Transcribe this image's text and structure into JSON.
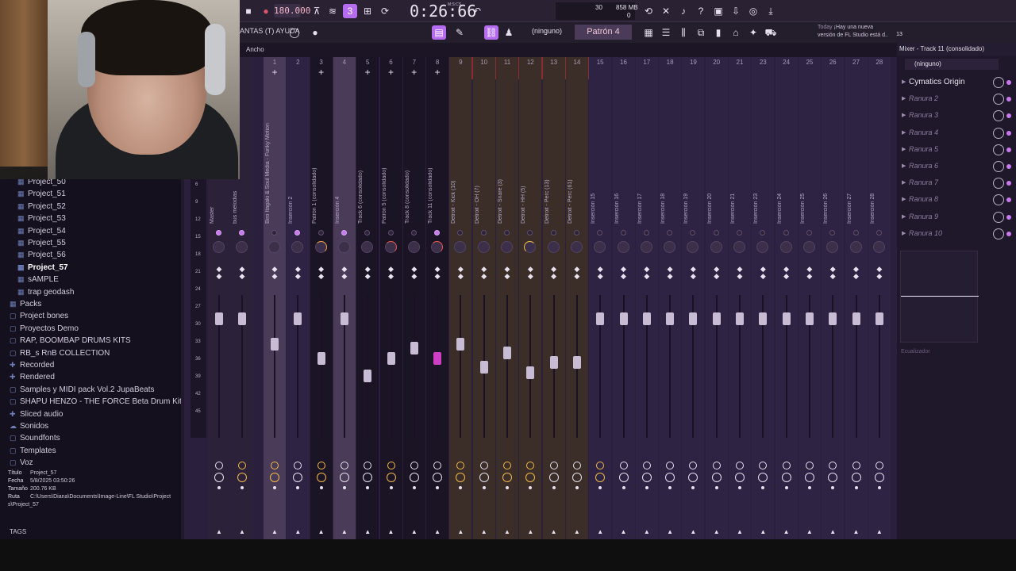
{
  "toolbar": {
    "tempo": "180.000",
    "timer": "0:26:66",
    "mcs": "M:S:CS",
    "cpu": "30",
    "memory": "858 MB",
    "zero": "0",
    "menu_text": "ANTAS (T) AYUDA",
    "snap": "(ninguno)",
    "pattern": "Patrón 4",
    "news_today": "Today",
    "news_line1": "¡Hay una nueva",
    "news_line2": "versión de FL Studio está d..",
    "news_count": "13"
  },
  "browser": {
    "items": [
      {
        "label": "Project_50",
        "icon": "▦",
        "top": 0
      },
      {
        "label": "Project_51",
        "icon": "▦"
      },
      {
        "label": "Project_52",
        "icon": "▦"
      },
      {
        "label": "Project_53",
        "icon": "▦"
      },
      {
        "label": "Project_54",
        "icon": "▦"
      },
      {
        "label": "Project_55",
        "icon": "▦"
      },
      {
        "label": "Project_56",
        "icon": "▦"
      },
      {
        "label": "Project_57",
        "icon": "▦"
      },
      {
        "label": "sAMPLE",
        "icon": "▦"
      },
      {
        "label": "trap geodash",
        "icon": "▦"
      },
      {
        "label": "Packs",
        "icon": "▦"
      },
      {
        "label": "Project bones",
        "icon": "▢"
      },
      {
        "label": "Proyectos Demo",
        "icon": "▢"
      },
      {
        "label": "RAP, BOOMBAP DRUMS KITS",
        "icon": "▢"
      },
      {
        "label": "RB_s RnB COLLECTION",
        "icon": "▢"
      },
      {
        "label": "Recorded",
        "icon": "✚"
      },
      {
        "label": "Rendered",
        "icon": "✚"
      },
      {
        "label": "Samples y MIDI pack Vol.2 JupaBeats",
        "icon": "▢"
      },
      {
        "label": "SHAPU HENZO - THE FORCE Beta Drum Kit",
        "icon": "▢"
      },
      {
        "label": "Sliced audio",
        "icon": "✚"
      },
      {
        "label": "Sonidos",
        "icon": "☁"
      },
      {
        "label": "Soundfonts",
        "icon": "▢"
      },
      {
        "label": "Templates",
        "icon": "▢"
      },
      {
        "label": "Voz",
        "icon": "▢"
      }
    ],
    "info": {
      "titulo_k": "Título",
      "titulo_v": "Project_57",
      "fecha_k": "Fecha",
      "fecha_v": "5/8/2025 03:50:26",
      "tamano_k": "Tamaño",
      "tamano_v": "200.76 KB",
      "ruta_k": "Ruta",
      "ruta_v": "C:\\Users\\Diana\\Documents\\Image-Line\\FL Studio\\Project",
      "ruta_v2": "s\\Project_57"
    },
    "tags_label": "TAGS"
  },
  "mixer": {
    "width_label": "Ancho",
    "ruler": [
      "6",
      "9",
      "12",
      "15",
      "18",
      "21",
      "24",
      "27",
      "30",
      "33",
      "36",
      "39",
      "42",
      "45"
    ],
    "tracks": [
      {
        "num": "",
        "name": "Master",
        "band": "band-d",
        "fader": 0.12,
        "send": true,
        "io_gold": false,
        "plus": false
      },
      {
        "num": "",
        "name": "bus melodias",
        "band": "band-d",
        "fader": 0.12,
        "send": true,
        "io_gold": true,
        "plus": false
      },
      {
        "num": "1",
        "name": "Biro Itagaki & Soul Media - Funky Motion",
        "band": "band-a",
        "fader": 0.3,
        "send": false,
        "io_gold": true,
        "plus": true
      },
      {
        "num": "2",
        "name": "Inserción 2",
        "band": "band-b",
        "fader": 0.12,
        "send": true,
        "io_gold": false,
        "plus": false
      },
      {
        "num": "3",
        "name": "Patrón 1 (consolidado)",
        "band": "band-dark",
        "fader": 0.4,
        "send": false,
        "io_gold": true,
        "plus": true
      },
      {
        "num": "4",
        "name": "Inserción 4",
        "band": "band-a",
        "fader": 0.12,
        "send": true,
        "io_gold": false,
        "plus": false
      },
      {
        "num": "5",
        "name": "Track 6 (consolidado)",
        "band": "band-dark",
        "fader": 0.52,
        "send": false,
        "io_gold": false,
        "plus": true
      },
      {
        "num": "6",
        "name": "Patrón 5 (consolidado)",
        "band": "band-dark",
        "fader": 0.4,
        "send": false,
        "io_gold": true,
        "plus": true
      },
      {
        "num": "7",
        "name": "Track 8 (consolidado)",
        "band": "band-dark",
        "fader": 0.33,
        "send": false,
        "io_gold": false,
        "plus": true
      },
      {
        "num": "8",
        "name": "Track 11 (consolidado)",
        "band": "band-dark",
        "fader": 0.4,
        "send": true,
        "io_gold": false,
        "plus": true,
        "active": true
      },
      {
        "num": "9",
        "name": "Detroit - Kick (10)",
        "band": "band-c",
        "fader": 0.3,
        "send": false,
        "io_gold": true,
        "plus": false
      },
      {
        "num": "10",
        "name": "Detroit - OH (7)",
        "band": "band-c",
        "fader": 0.46,
        "send": false,
        "io_gold": false,
        "plus": false
      },
      {
        "num": "11",
        "name": "Detroit - Snare (3)",
        "band": "band-c",
        "fader": 0.36,
        "send": false,
        "io_gold": true,
        "plus": false
      },
      {
        "num": "12",
        "name": "Detroit - HH (5)",
        "band": "band-c",
        "fader": 0.5,
        "send": false,
        "io_gold": true,
        "plus": false
      },
      {
        "num": "13",
        "name": "Detroit - Perc (13)",
        "band": "band-c",
        "fader": 0.43,
        "send": false,
        "io_gold": false,
        "plus": false
      },
      {
        "num": "14",
        "name": "Detroit - Perc (61)",
        "band": "band-c",
        "fader": 0.43,
        "send": false,
        "io_gold": false,
        "plus": false
      },
      {
        "num": "15",
        "name": "Inserción 15",
        "band": "band-b",
        "fader": 0.12,
        "send": false,
        "io_gold": true,
        "plus": false
      },
      {
        "num": "16",
        "name": "Inserción 16",
        "band": "band-b",
        "fader": 0.12,
        "send": false,
        "io_gold": false,
        "plus": false
      },
      {
        "num": "17",
        "name": "Inserción 17",
        "band": "band-b",
        "fader": 0.12,
        "send": false,
        "io_gold": false,
        "plus": false
      },
      {
        "num": "18",
        "name": "Inserción 18",
        "band": "band-b",
        "fader": 0.12,
        "send": false,
        "io_gold": false,
        "plus": false
      },
      {
        "num": "19",
        "name": "Inserción 19",
        "band": "band-b",
        "fader": 0.12,
        "send": false,
        "io_gold": false,
        "plus": false
      },
      {
        "num": "20",
        "name": "Inserción 20",
        "band": "band-b",
        "fader": 0.12,
        "send": false,
        "io_gold": false,
        "plus": false
      },
      {
        "num": "21",
        "name": "Inserción 21",
        "band": "band-b",
        "fader": 0.12,
        "send": false,
        "io_gold": false,
        "plus": false
      },
      {
        "num": "23",
        "name": "Inserción 23",
        "band": "band-b",
        "fader": 0.12,
        "send": false,
        "io_gold": false,
        "plus": false
      },
      {
        "num": "24",
        "name": "Inserción 24",
        "band": "band-b",
        "fader": 0.12,
        "send": false,
        "io_gold": false,
        "plus": false
      },
      {
        "num": "25",
        "name": "Inserción 25",
        "band": "band-b",
        "fader": 0.12,
        "send": false,
        "io_gold": false,
        "plus": false
      },
      {
        "num": "26",
        "name": "Inserción 26",
        "band": "band-b",
        "fader": 0.12,
        "send": false,
        "io_gold": false,
        "plus": false
      },
      {
        "num": "27",
        "name": "Inserción 27",
        "band": "band-b",
        "fader": 0.12,
        "send": false,
        "io_gold": false,
        "plus": false
      },
      {
        "num": "28",
        "name": "Inserción 28",
        "band": "band-b",
        "fader": 0.12,
        "send": false,
        "io_gold": false,
        "plus": false
      }
    ]
  },
  "right_panel": {
    "title": "Mixer - Track 11 (consolidado)",
    "none": "(ninguno)",
    "slots": [
      "Cymatics Origin",
      "Ranura 2",
      "Ranura 3",
      "Ranura 4",
      "Ranura 5",
      "Ranura 6",
      "Ranura 7",
      "Ranura 8",
      "Ranura 9",
      "Ranura 10"
    ],
    "eq_label": "Ecualizador"
  },
  "colors": {
    "accent": "#c879f0",
    "fader_active": "#cf3fc6",
    "red_header": "#8a2c34"
  }
}
